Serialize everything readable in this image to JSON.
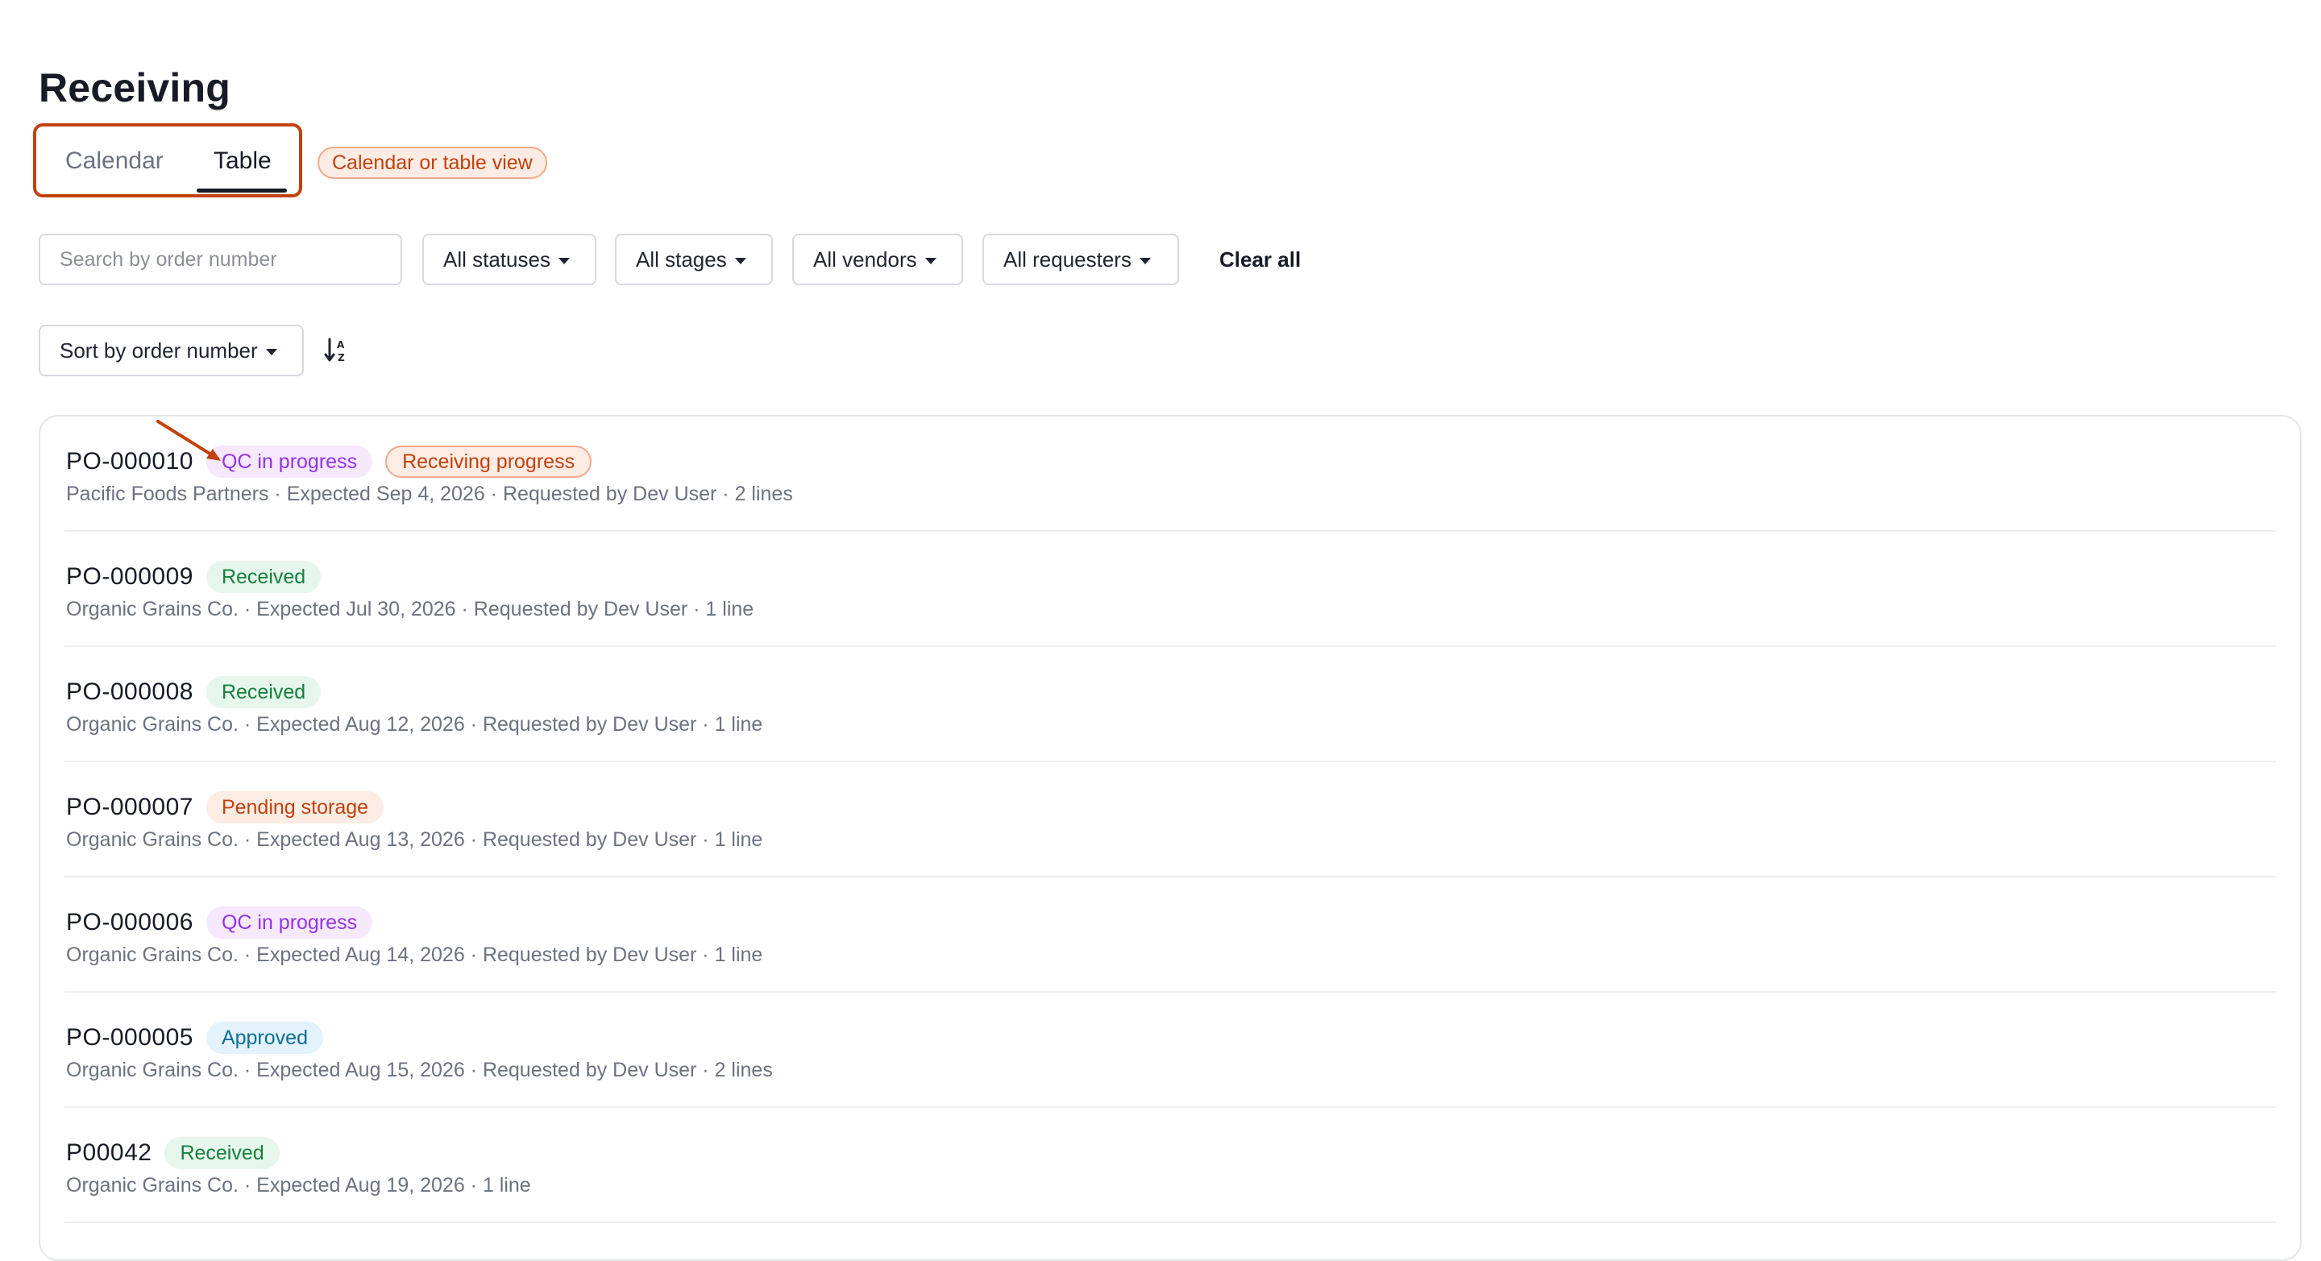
{
  "page": {
    "title": "Receiving"
  },
  "tabs": {
    "calendar_label": "Calendar",
    "table_label": "Table",
    "hint": "Calendar or table view"
  },
  "filters": {
    "search_placeholder": "Search by order number",
    "status_label": "All statuses",
    "stage_label": "All stages",
    "vendor_label": "All vendors",
    "requester_label": "All requesters",
    "clear_all_label": "Clear all",
    "sort_label": "Sort by order number",
    "sort_direction_icon": "sort-ascending-alpha-icon"
  },
  "colors": {
    "accent": "#c2410c",
    "qc_bg": "#f6e8fd",
    "qc_fg": "#9333ea",
    "received_bg": "#e7f6ec",
    "received_fg": "#15803d",
    "pending_bg": "#fdece4",
    "pending_fg": "#c2410c",
    "approved_bg": "#e3f2fb",
    "approved_fg": "#0e6f96"
  },
  "orders": [
    {
      "number": "PO-000010",
      "badges": [
        {
          "label": "QC in progress",
          "bg": "#f6e8fd",
          "fg": "#9333ea",
          "outlined": false
        },
        {
          "label": "Receiving progress",
          "bg": "#fdece4",
          "fg": "#c2410c",
          "outlined": true
        }
      ],
      "details": "Pacific Foods Partners · Expected Sep 4, 2026 · Requested by Dev User · 2 lines"
    },
    {
      "number": "PO-000009",
      "badges": [
        {
          "label": "Received",
          "bg": "#e7f6ec",
          "fg": "#15803d",
          "outlined": false
        }
      ],
      "details": "Organic Grains Co. · Expected Jul 30, 2026 · Requested by Dev User · 1 line"
    },
    {
      "number": "PO-000008",
      "badges": [
        {
          "label": "Received",
          "bg": "#e7f6ec",
          "fg": "#15803d",
          "outlined": false
        }
      ],
      "details": "Organic Grains Co. · Expected Aug 12, 2026 · Requested by Dev User · 1 line"
    },
    {
      "number": "PO-000007",
      "badges": [
        {
          "label": "Pending storage",
          "bg": "#fdece4",
          "fg": "#c2410c",
          "outlined": false
        }
      ],
      "details": "Organic Grains Co. · Expected Aug 13, 2026 · Requested by Dev User · 1 line"
    },
    {
      "number": "PO-000006",
      "badges": [
        {
          "label": "QC in progress",
          "bg": "#f6e8fd",
          "fg": "#9333ea",
          "outlined": false
        }
      ],
      "details": "Organic Grains Co. · Expected Aug 14, 2026 · Requested by Dev User · 1 line"
    },
    {
      "number": "PO-000005",
      "badges": [
        {
          "label": "Approved",
          "bg": "#e3f2fb",
          "fg": "#0e6f96",
          "outlined": false
        }
      ],
      "details": "Organic Grains Co. · Expected Aug 15, 2026 · Requested by Dev User · 2 lines"
    },
    {
      "number": "P00042",
      "badges": [
        {
          "label": "Received",
          "bg": "#e7f6ec",
          "fg": "#15803d",
          "outlined": false
        }
      ],
      "details": "Organic Grains Co. · Expected Aug 19, 2026 · 1 line"
    }
  ]
}
